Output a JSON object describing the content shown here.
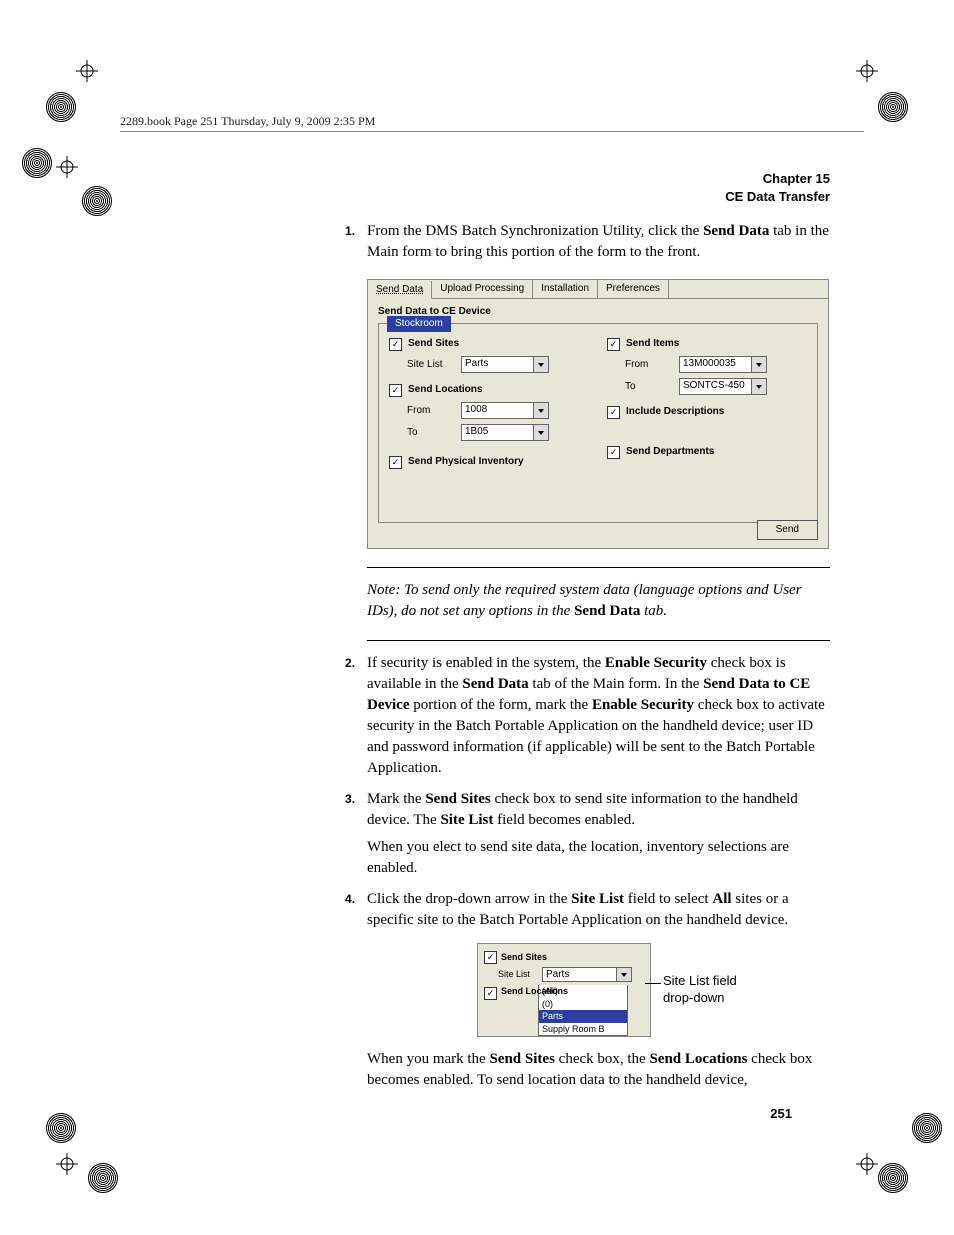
{
  "header_line": "2289.book  Page 251  Thursday, July 9, 2009  2:35 PM",
  "chapter_hdr_line1": "Chapter 15",
  "chapter_hdr_line2": "CE Data Transfer",
  "step1_a": "From the DMS Batch Synchronization Utility, click the ",
  "step1_b": "Send Data",
  "step1_c": " tab in the Main form to bring this portion of the form to the front.",
  "dialog": {
    "tabs": [
      "Send Data",
      "Upload Processing",
      "Installation",
      "Preferences"
    ],
    "section_title": "Send Data to CE Device",
    "group_label": "Stockroom",
    "left": {
      "send_sites": "Send Sites",
      "site_list_lbl": "Site List",
      "site_list_val": "Parts",
      "send_locations": "Send Locations",
      "from_lbl": "From",
      "from_val": "1008",
      "to_lbl": "To",
      "to_val": "1B05",
      "send_phys_inv": "Send Physical Inventory"
    },
    "right": {
      "send_items": "Send Items",
      "from_lbl": "From",
      "from_val": "13M000035",
      "to_lbl": "To",
      "to_val": "SONTCS-450",
      "include_desc": "Include Descriptions",
      "send_depts": "Send Departments"
    },
    "send_btn": "Send"
  },
  "note_prefix": "Note:   To send only the required system data (language options and User IDs), do not set any options in the ",
  "note_b": "Send Data",
  "note_suffix": " tab.",
  "step2_a": "If security is enabled in the system, the ",
  "step2_b1": "Enable Security",
  "step2_c": " check box is available in the ",
  "step2_b2": "Send Data",
  "step2_d": " tab of the Main form. In the ",
  "step2_b3": "Send Data to CE Device",
  "step2_e": " portion of the form, mark the ",
  "step2_b4": "Enable Security",
  "step2_f": " check box to activate security in the Batch Portable Application on the handheld device; user ID and password information (if applicable) will be sent to the Batch Portable Application.",
  "step3_a": "Mark the ",
  "step3_b1": "Send Sites",
  "step3_c": " check box to send site information to the handheld device. The ",
  "step3_b2": "Site List",
  "step3_d": " field becomes enabled.",
  "step3_sub": "When you elect to send site data, the location, inventory selections are enabled.",
  "step4_a": "Click the drop-down arrow in the ",
  "step4_b1": "Site List",
  "step4_c": " field to select ",
  "step4_b2": "All",
  "step4_d": " sites or a specific site to the Batch Portable Application on the handheld device.",
  "mini": {
    "send_sites": "Send Sites",
    "site_list_lbl": "Site List",
    "site_list_val": "Parts",
    "send_locations": "Send Locations",
    "opts": [
      "(All)",
      "(0)",
      "Parts",
      "Supply Room B"
    ]
  },
  "callout1": "Site List field",
  "callout2": "drop-down",
  "tail_a": "When you mark the ",
  "tail_b1": "Send Sites",
  "tail_c": " check box, the ",
  "tail_b2": "Send Locations",
  "tail_d": " check box becomes enabled. To send location data to the handheld device,",
  "page_num": "251"
}
